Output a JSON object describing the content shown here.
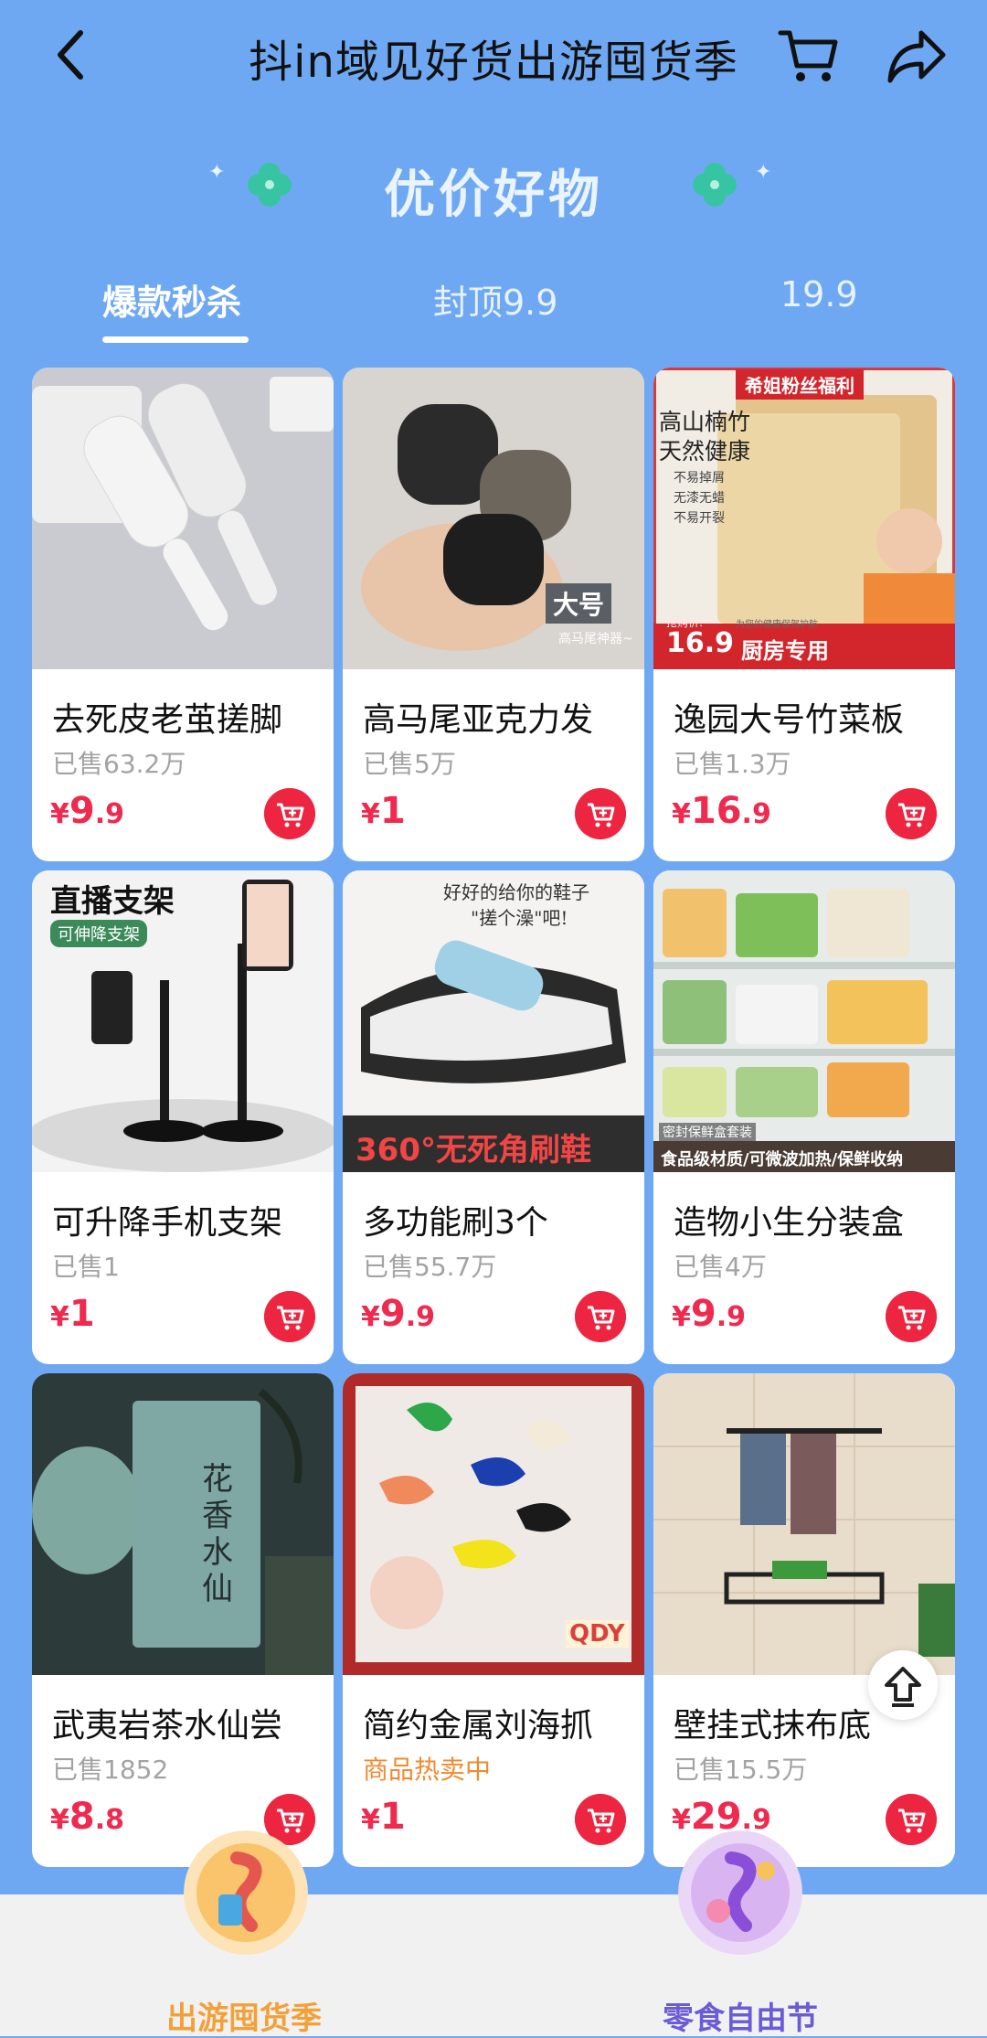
{
  "header": {
    "title": "抖in域见好货出游囤货季"
  },
  "section": {
    "heading": "优价好物"
  },
  "tabs": [
    {
      "label": "爆款秒杀",
      "active": true
    },
    {
      "label": "封顶9.9",
      "active": false
    },
    {
      "label": "19.9",
      "active": false
    }
  ],
  "products": [
    {
      "name": "去死皮老茧搓脚",
      "sold": "已售63.2万",
      "price_currency": "¥",
      "price_int": "9",
      "price_dec": ".9",
      "image": "foot-file-image"
    },
    {
      "name": "高马尾亚克力发",
      "sold": "已售5万",
      "price_currency": "¥",
      "price_int": "1",
      "price_dec": "",
      "image": "hair-claw-image",
      "badge": "大号",
      "badge_sub": "高马尾神器~"
    },
    {
      "name": "逸园大号竹菜板",
      "sold": "已售1.3万",
      "price_currency": "¥",
      "price_int": "16",
      "price_dec": ".9",
      "image": "cutting-board-image",
      "banner": "希姐粉丝福利",
      "line1": "高山楠竹",
      "line2": "天然健康",
      "bullets": [
        "不易掉屑",
        "无漆无蜡",
        "不易开裂"
      ],
      "footer_price": "16.9",
      "footer_label": "厨房专用",
      "footer_small": "抢购价:",
      "footer_note": "为您的健康保驾护航"
    },
    {
      "name": "可升降手机支架",
      "sold": "已售1",
      "price_currency": "¥",
      "price_int": "1",
      "price_dec": "",
      "image": "phone-stand-image",
      "badge": "直播支架",
      "badge_sub": "可伸降支架"
    },
    {
      "name": "多功能刷3个",
      "sold": "已售55.7万",
      "price_currency": "¥",
      "price_int": "9",
      "price_dec": ".9",
      "image": "shoe-brush-image",
      "top_text1": "好好的给你的鞋子",
      "top_text2": "\"搓个澡\"吧!",
      "banner": "360°无死角刷鞋"
    },
    {
      "name": "造物小生分装盒",
      "sold": "已售4万",
      "price_currency": "¥",
      "price_int": "9",
      "price_dec": ".9",
      "image": "storage-box-image",
      "banner_small": "密封保鲜盒套装",
      "banner": "食品级材质/可微波加热/保鲜收纳"
    },
    {
      "name": "武夷岩茶水仙尝",
      "sold": "已售1852",
      "price_currency": "¥",
      "price_int": "8",
      "price_dec": ".8",
      "image": "tea-pack-image",
      "badge": "花香水仙"
    },
    {
      "name": "简约金属刘海抓",
      "sold": "商品热卖中",
      "sold_hot": true,
      "price_currency": "¥",
      "price_int": "1",
      "price_dec": "",
      "image": "hair-clips-image",
      "badge": "QDY"
    },
    {
      "name": "壁挂式抹布底",
      "sold": "已售15.5万",
      "price_currency": "¥",
      "price_int": "29",
      "price_dec": ".9",
      "image": "towel-rack-image"
    }
  ],
  "bottom_nav": [
    {
      "label": "出游囤货季",
      "color": "#f2a13a"
    },
    {
      "label": "零食自由节",
      "color": "#6a5bd6"
    }
  ],
  "colors": {
    "background": "#6fa8f2",
    "price": "#ef2a4f",
    "cart_button": "#ee2540"
  }
}
